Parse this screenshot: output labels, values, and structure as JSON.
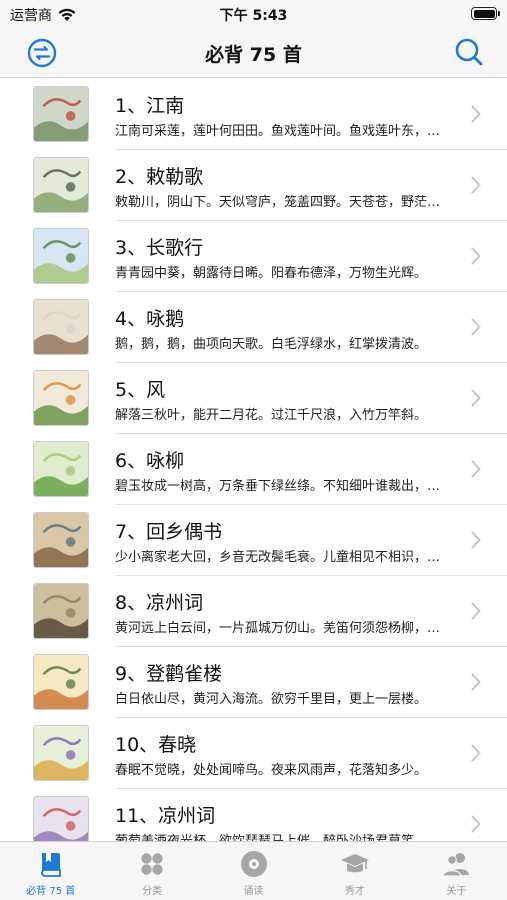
{
  "status_bar": {
    "carrier": "运营商",
    "time": "下午 5:43",
    "battery_level": 1.0
  },
  "nav": {
    "title": "必背 75 首",
    "left_icon": "menu-switch-icon",
    "right_icon": "search-icon"
  },
  "poems": [
    {
      "title": "1、江南",
      "excerpt": "江南可采莲，莲叶何田田。鱼戏莲叶间。鱼戏莲叶东，鱼戏莲叶西，鱼戏莲叶南，鱼戏莲叶北。"
    },
    {
      "title": "2、敕勒歌",
      "excerpt": "敕勒川，阴山下。天似穹庐，笼盖四野。天苍苍，野茫茫，风吹草低见牛羊。"
    },
    {
      "title": "3、长歌行",
      "excerpt": "青青园中葵，朝露待日晞。阳春布德泽，万物生光辉。"
    },
    {
      "title": "4、咏鹅",
      "excerpt": "鹅，鹅，鹅，曲项向天歌。白毛浮绿水，红掌拨清波。"
    },
    {
      "title": "5、风",
      "excerpt": "解落三秋叶，能开二月花。过江千尺浪，入竹万竿斜。"
    },
    {
      "title": "6、咏柳",
      "excerpt": "碧玉妆成一树高，万条垂下绿丝绦。不知细叶谁裁出，二月春风似剪刀。"
    },
    {
      "title": "7、回乡偶书",
      "excerpt": "少小离家老大回，乡音无改鬓毛衰。儿童相见不相识，笑问客从何处来。"
    },
    {
      "title": "8、凉州词",
      "excerpt": "黄河远上白云间，一片孤城万仞山。羌笛何须怨杨柳，春风不度玉门关。"
    },
    {
      "title": "9、登鹳雀楼",
      "excerpt": "白日依山尽，黄河入海流。欲穷千里目，更上一层楼。"
    },
    {
      "title": "10、春晓",
      "excerpt": "春眠不觉晓，处处闻啼鸟。夜来风雨声，花落知多少。"
    },
    {
      "title": "11、凉州词",
      "excerpt": "葡萄美酒夜光杯，欲饮琵琶马上催。醉卧沙场君莫笑，古来征战几人回。"
    }
  ],
  "tabs": [
    {
      "label": "必背 75 首",
      "icon": "book-icon",
      "active": true
    },
    {
      "label": "分类",
      "icon": "grid-icon",
      "active": false
    },
    {
      "label": "诵读",
      "icon": "disc-icon",
      "active": false
    },
    {
      "label": "秀才",
      "icon": "graduation-cap-icon",
      "active": false
    },
    {
      "label": "关于",
      "icon": "people-icon",
      "active": false
    }
  ],
  "colors": {
    "accent": "#1f7ad6",
    "inactive_icon": "#a6a6a6",
    "bar_background": "#f6f6f6"
  }
}
